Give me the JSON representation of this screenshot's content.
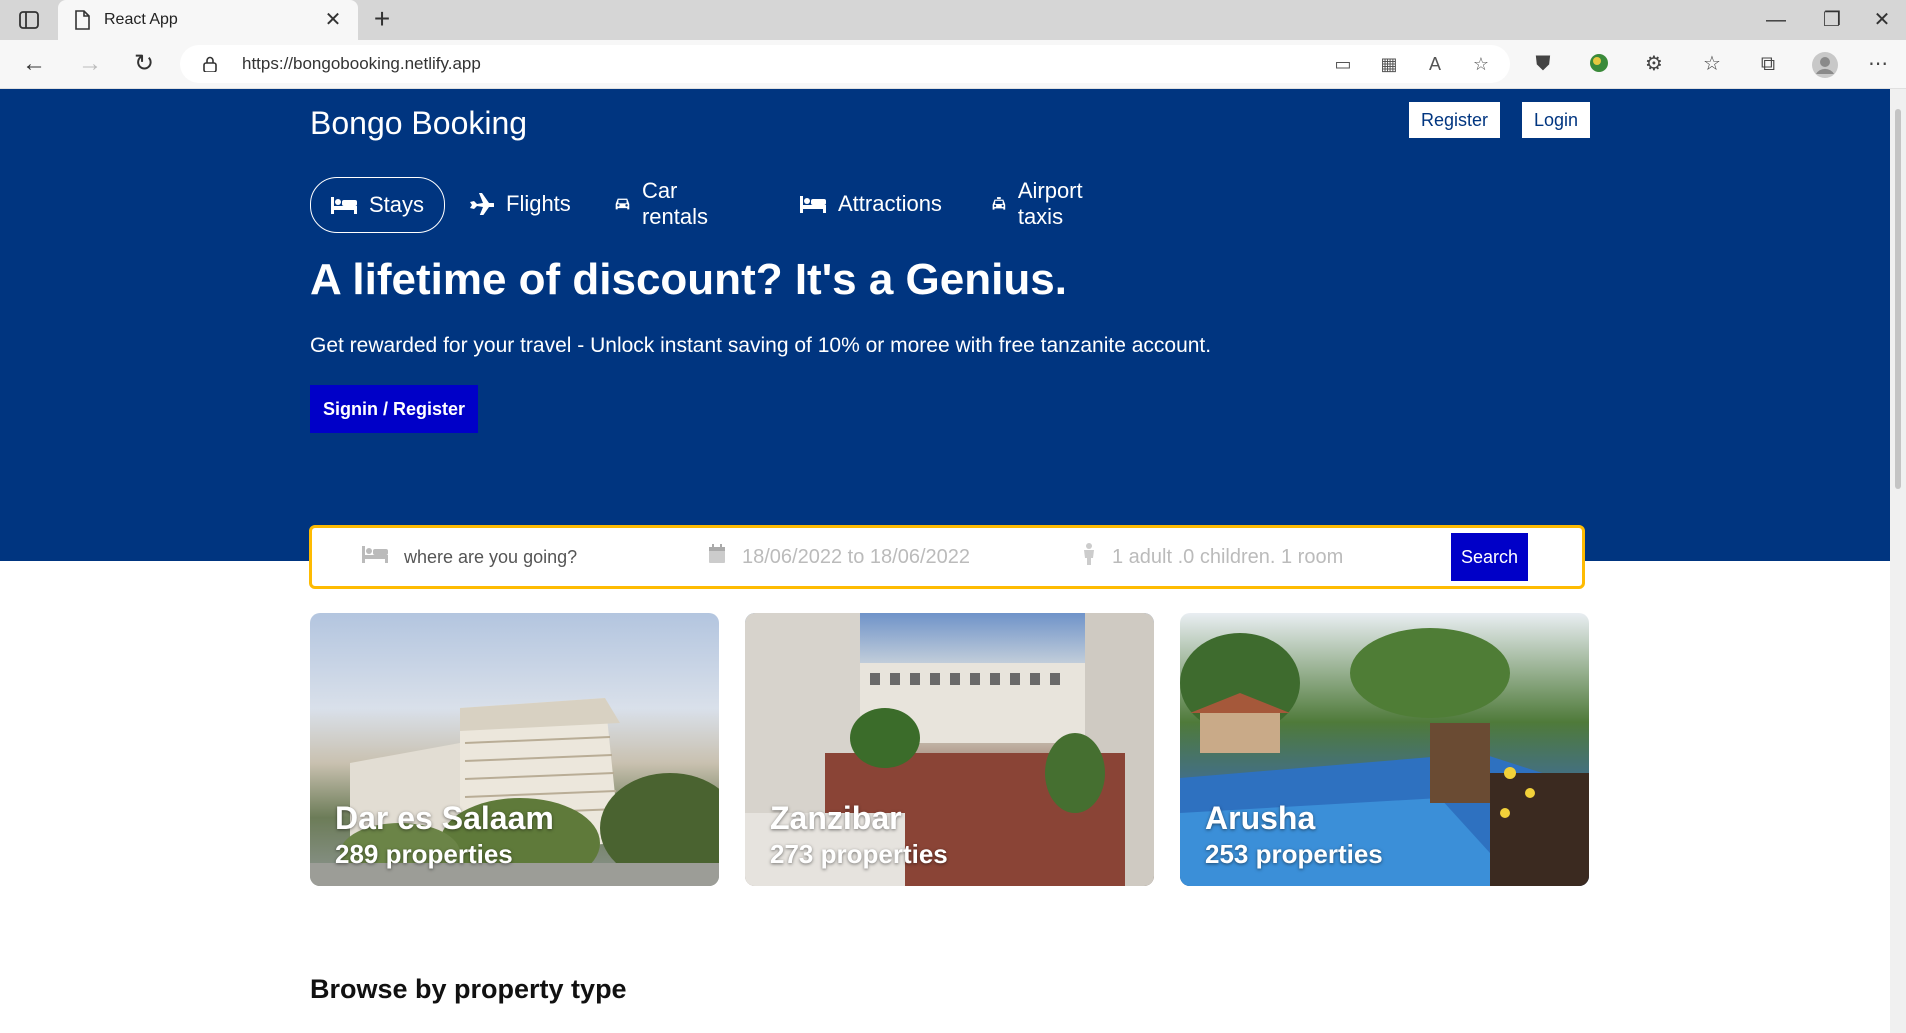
{
  "browser": {
    "tab_title": "React App",
    "url": "https://bongobooking.netlify.app"
  },
  "header": {
    "logo": "Bongo Booking",
    "register_label": "Register",
    "login_label": "Login"
  },
  "nav": {
    "items": [
      {
        "label": "Stays",
        "icon": "bed-icon",
        "active": true
      },
      {
        "label": "Flights",
        "icon": "plane-icon"
      },
      {
        "label": "Car rentals",
        "icon": "car-icon"
      },
      {
        "label": "Attractions",
        "icon": "bed-icon"
      },
      {
        "label": "Airport taxis",
        "icon": "taxi-icon"
      }
    ]
  },
  "hero": {
    "title": "A lifetime of discount? It's a Genius.",
    "description": "Get rewarded for your travel - Unlock instant saving of 10% or moree with free tanzanite account.",
    "signin_label": "Signin / Register"
  },
  "search": {
    "destination_placeholder": "where are you going?",
    "dates": "18/06/2022 to 18/06/2022",
    "guests": "1 adult .0 children. 1 room",
    "button_label": "Search"
  },
  "featured": [
    {
      "name": "Dar es Salaam",
      "count": "289 properties"
    },
    {
      "name": "Zanzibar",
      "count": "273 properties"
    },
    {
      "name": "Arusha",
      "count": "253 properties"
    }
  ],
  "sections": {
    "property_type_title": "Browse by property type"
  },
  "colors": {
    "brand_blue": "#003580",
    "button_blue": "#0000c8",
    "search_border": "#febb02"
  }
}
